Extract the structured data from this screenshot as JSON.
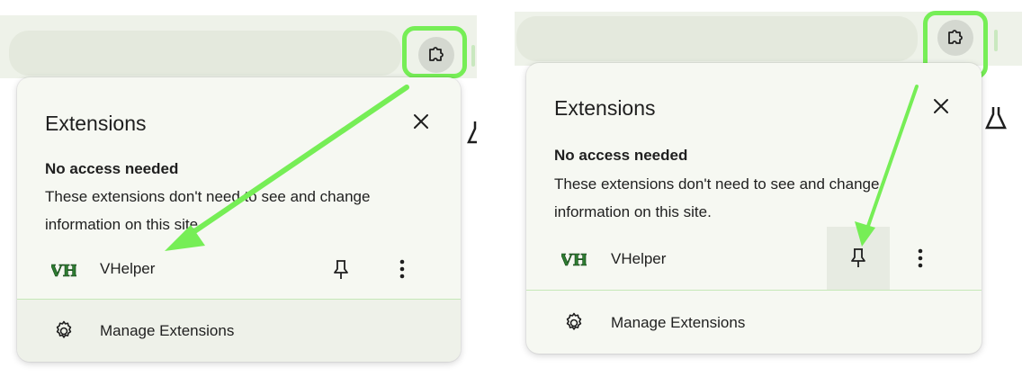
{
  "popup": {
    "title": "Extensions",
    "section_title": "No access needed",
    "section_desc": "These extensions don't need to see and change information on this site.",
    "extension": {
      "name": "VHelper",
      "logo_text": "VH"
    },
    "manage_label": "Manage Extensions"
  },
  "icons": {
    "toolbar": "puzzle-icon",
    "close": "close-icon",
    "pin": "pin-icon",
    "more": "more-vert-icon",
    "manage": "gear-icon",
    "lab": "flask-icon"
  },
  "colors": {
    "highlight": "#76ee56",
    "popup_bg": "#f6f8f2",
    "divider": "#c6e8b8",
    "toolbar_bg": "#eef2e9",
    "logo_green": "#2e7d32"
  }
}
